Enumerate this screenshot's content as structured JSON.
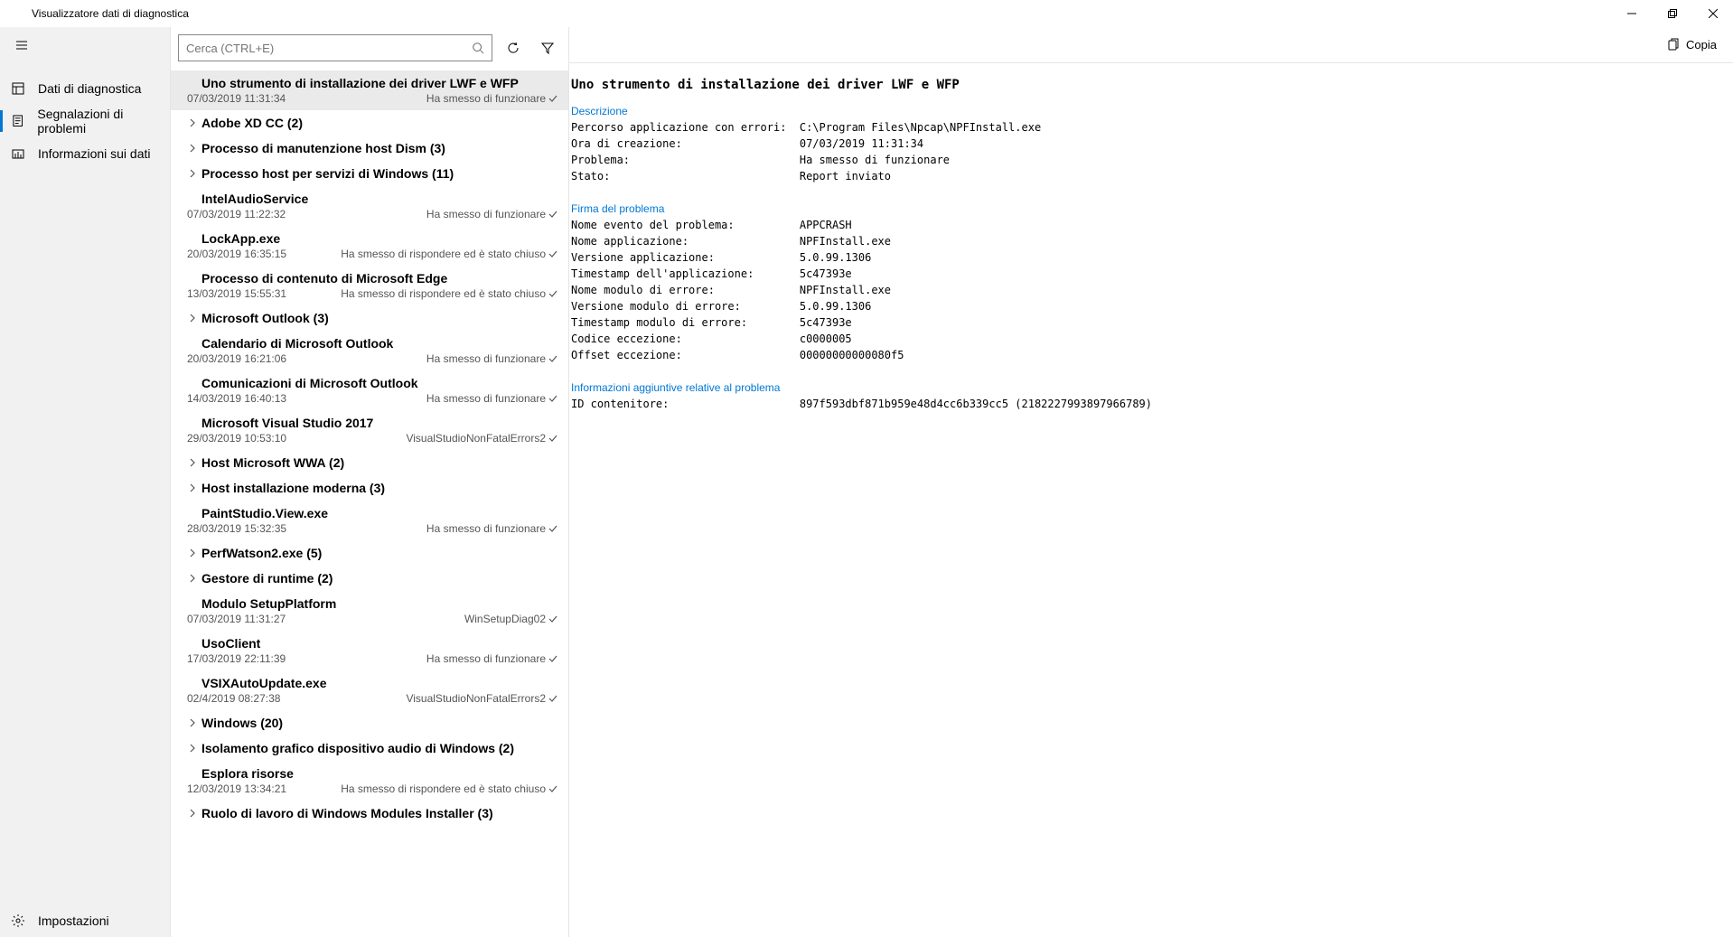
{
  "window": {
    "title": "Visualizzatore dati di diagnostica"
  },
  "sidebar": {
    "items": [
      {
        "label": "Dati di diagnostica",
        "icon": "data"
      },
      {
        "label": "Segnalazioni di problemi",
        "icon": "report",
        "active": true
      },
      {
        "label": "Informazioni sui dati",
        "icon": "info"
      }
    ],
    "settings": "Impostazioni"
  },
  "toolbar": {
    "search_placeholder": "Cerca (CTRL+E)",
    "copy_label": "Copia"
  },
  "events": [
    {
      "title": "Uno strumento di installazione dei driver LWF e WFP",
      "date": "07/03/2019 11:31:34",
      "status": "Ha smesso di funzionare",
      "expandable": false,
      "selected": true
    },
    {
      "title": "Adobe XD CC (2)",
      "expandable": true
    },
    {
      "title": "Processo di manutenzione host Dism (3)",
      "expandable": true
    },
    {
      "title": "Processo host per servizi di Windows (11)",
      "expandable": true
    },
    {
      "title": "IntelAudioService",
      "date": "07/03/2019 11:22:32",
      "status": "Ha smesso di funzionare",
      "expandable": false
    },
    {
      "title": "LockApp.exe",
      "date": "20/03/2019 16:35:15",
      "status": "Ha smesso di rispondere ed è stato chiuso",
      "expandable": false
    },
    {
      "title": "Processo di contenuto di Microsoft Edge",
      "date": "13/03/2019 15:55:31",
      "status": "Ha smesso di rispondere ed è stato chiuso",
      "expandable": false
    },
    {
      "title": "Microsoft Outlook (3)",
      "expandable": true
    },
    {
      "title": "Calendario di Microsoft Outlook",
      "date": "20/03/2019 16:21:06",
      "status": "Ha smesso di funzionare",
      "expandable": false
    },
    {
      "title": "Comunicazioni di Microsoft Outlook",
      "date": "14/03/2019 16:40:13",
      "status": "Ha smesso di funzionare",
      "expandable": false
    },
    {
      "title": "Microsoft Visual Studio 2017",
      "date": "29/03/2019 10:53:10",
      "status": "VisualStudioNonFatalErrors2",
      "expandable": false
    },
    {
      "title": "Host Microsoft WWA (2)",
      "expandable": true
    },
    {
      "title": "Host installazione moderna (3)",
      "expandable": true
    },
    {
      "title": "PaintStudio.View.exe",
      "date": "28/03/2019 15:32:35",
      "status": "Ha smesso di funzionare",
      "expandable": false
    },
    {
      "title": "PerfWatson2.exe (5)",
      "expandable": true
    },
    {
      "title": "Gestore di runtime (2)",
      "expandable": true
    },
    {
      "title": "Modulo SetupPlatform",
      "date": "07/03/2019 11:31:27",
      "status": "WinSetupDiag02",
      "expandable": false
    },
    {
      "title": "UsoClient",
      "date": "17/03/2019 22:11:39",
      "status": "Ha smesso di funzionare",
      "expandable": false
    },
    {
      "title": "VSIXAutoUpdate.exe",
      "date": "02/4/2019 08:27:38",
      "status": "VisualStudioNonFatalErrors2",
      "expandable": false
    },
    {
      "title": "Windows (20)",
      "expandable": true
    },
    {
      "title": "Isolamento grafico dispositivo audio di Windows (2)",
      "expandable": true
    },
    {
      "title": "Esplora risorse",
      "date": "12/03/2019 13:34:21",
      "status": "Ha smesso di rispondere ed è stato chiuso",
      "expandable": false
    },
    {
      "title": "Ruolo di lavoro di Windows Modules Installer (3)",
      "expandable": true
    }
  ],
  "detail": {
    "title": "Uno strumento di installazione dei driver LWF e WFP",
    "sections": [
      {
        "head": "Descrizione",
        "rows": [
          [
            "Percorso applicazione con errori:",
            "C:\\Program Files\\Npcap\\NPFInstall.exe"
          ],
          [
            "Ora di creazione:",
            "07/03/2019 11:31:34"
          ],
          [
            "Problema:",
            "Ha smesso di funzionare"
          ],
          [
            "Stato:",
            "Report inviato"
          ]
        ]
      },
      {
        "head": "Firma del problema",
        "rows": [
          [
            "Nome evento del problema:",
            "APPCRASH"
          ],
          [
            "Nome applicazione:",
            "NPFInstall.exe"
          ],
          [
            "Versione applicazione:",
            "5.0.99.1306"
          ],
          [
            "Timestamp dell'applicazione:",
            "5c47393e"
          ],
          [
            "Nome modulo di errore:",
            "NPFInstall.exe"
          ],
          [
            "Versione modulo di errore:",
            "5.0.99.1306"
          ],
          [
            "Timestamp modulo di errore:",
            "5c47393e"
          ],
          [
            "Codice eccezione:",
            "c0000005"
          ],
          [
            "Offset eccezione:",
            "00000000000080f5"
          ]
        ]
      },
      {
        "head": "Informazioni aggiuntive relative al problema",
        "rows": [
          [
            "ID contenitore:",
            "897f593dbf871b959e48d4cc6b339cc5 (2182227993897966789)"
          ]
        ]
      }
    ]
  }
}
